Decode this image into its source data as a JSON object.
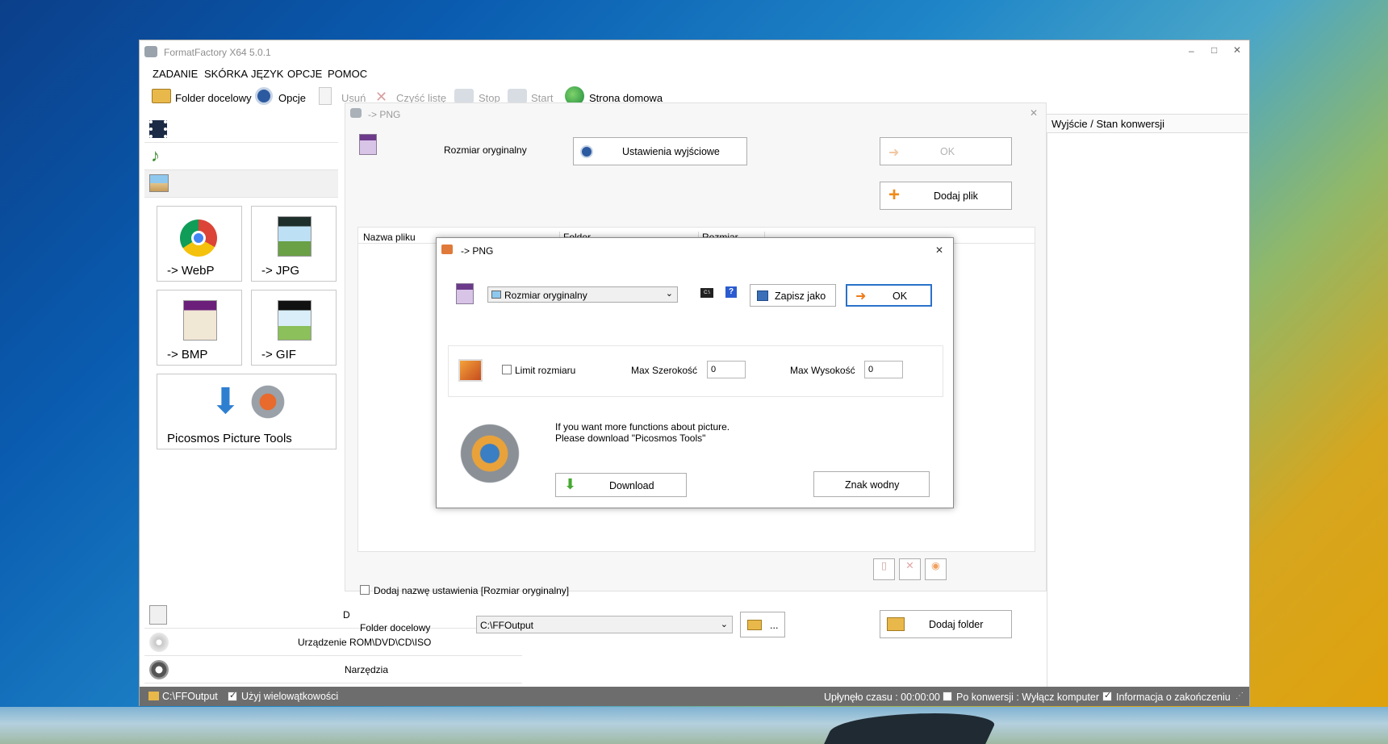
{
  "window": {
    "title": "FormatFactory X64 5.0.1",
    "controls": [
      "–",
      "□",
      "✕"
    ]
  },
  "menu": [
    "ZADANIE",
    "SKÓRKA",
    "JĘZYK",
    "OPCJE",
    "POMOC"
  ],
  "toolbar": {
    "folder": "Folder docelowy",
    "options": "Opcje",
    "remove": "Usuń",
    "clear": "Czyść listę",
    "stop": "Stop",
    "start": "Start",
    "home": "Strona domowa"
  },
  "sidebar": {
    "tiles": [
      "-> WebP",
      "-> JPG",
      "-> BMP",
      "-> GIF",
      "Picosmos Picture Tools"
    ],
    "bottom": [
      "D",
      "Urządzenie ROM\\DVD\\CD\\ISO",
      "Narzędzia"
    ]
  },
  "output_panel": {
    "header": "Wyjście / Stan konwersji"
  },
  "convert": {
    "title": "-> PNG",
    "original_size": "Rozmiar oryginalny",
    "output_settings": "Ustawienia wyjściowe",
    "ok": "OK",
    "add_file": "Dodaj plik",
    "columns": [
      "Nazwa pliku",
      "Folder",
      "Rozmiar"
    ],
    "add_setting_name": "Dodaj nazwę ustawienia [Rozmiar oryginalny]",
    "dest_label": "Folder docelowy",
    "dest_value": "C:\\FFOutput",
    "browse": "...",
    "add_folder": "Dodaj folder"
  },
  "dialog": {
    "title": "-> PNG",
    "preset": "Rozmiar oryginalny",
    "save_as": "Zapisz jako",
    "ok": "OK",
    "limit": "Limit rozmiaru",
    "max_w_label": "Max Szerokość",
    "max_w": "0",
    "max_h_label": "Max Wysokość",
    "max_h": "0",
    "info_line1": "If you want more functions about picture.",
    "info_line2": "Please download \"Picosmos Tools\"",
    "download": "Download",
    "watermark": "Znak wodny",
    "close": "✕",
    "help": "?",
    "cmd": "C:\\"
  },
  "status": {
    "path": "C:\\FFOutput",
    "multithread": "Użyj wielowątkowości",
    "elapsed": "Upłynęło czasu : 00:00:00",
    "after": "Po konwersji : Wyłącz komputer",
    "notify": "Informacja o zakończeniu"
  }
}
